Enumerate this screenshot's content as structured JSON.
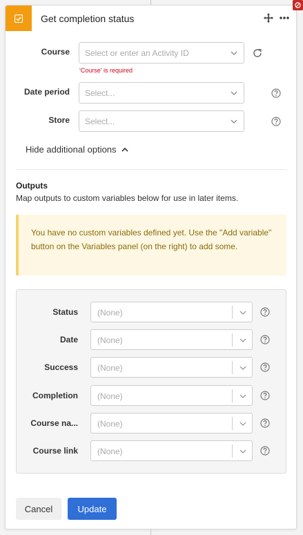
{
  "header": {
    "title": "Get completion status",
    "icon": "checkbox-icon",
    "accent_color": "#f39c12"
  },
  "form": {
    "course": {
      "label": "Course",
      "placeholder": "Select or enter an Activity ID",
      "error": "'Course' is required"
    },
    "date_period": {
      "label": "Date period",
      "placeholder": "Select..."
    },
    "store": {
      "label": "Store",
      "placeholder": "Select..."
    },
    "toggle_label": "Hide additional options"
  },
  "outputs": {
    "title": "Outputs",
    "description": "Map outputs to custom variables below for use in later items.",
    "warning": "You have no custom variables defined yet. Use the \"Add variable\" button on the Variables panel (on the right) to add some.",
    "rows": [
      {
        "label": "Status",
        "value": "(None)"
      },
      {
        "label": "Date",
        "value": "(None)"
      },
      {
        "label": "Success",
        "value": "(None)"
      },
      {
        "label": "Completion",
        "value": "(None)"
      },
      {
        "label": "Course na...",
        "value": "(None)"
      },
      {
        "label": "Course link",
        "value": "(None)"
      }
    ]
  },
  "footer": {
    "cancel_label": "Cancel",
    "update_label": "Update",
    "primary_color": "#2f6fd6"
  }
}
